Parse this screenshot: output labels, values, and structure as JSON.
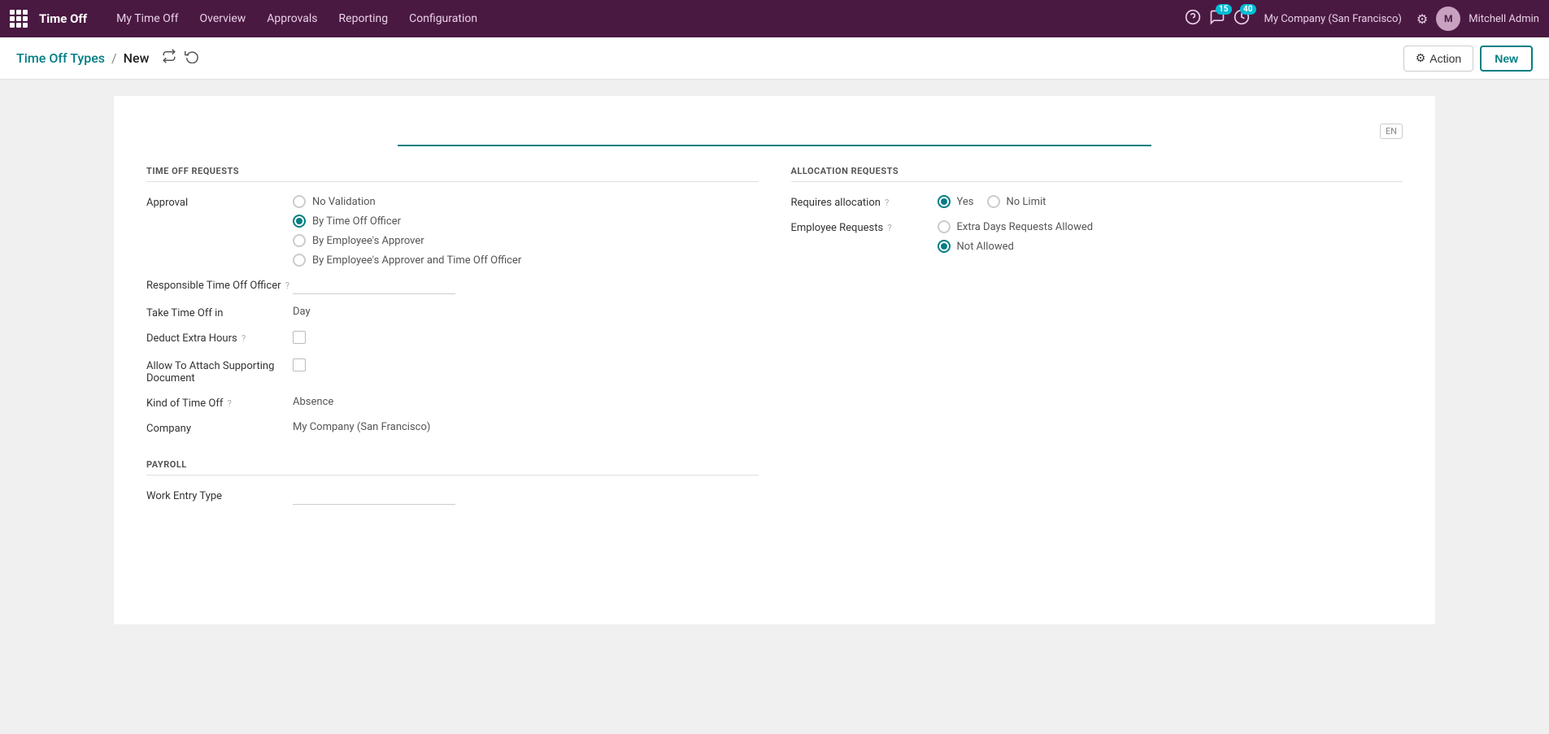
{
  "app": {
    "name": "Time Off",
    "menu": [
      "My Time Off",
      "Overview",
      "Approvals",
      "Reporting",
      "Configuration"
    ]
  },
  "topnav": {
    "badges": {
      "chat": "15",
      "clock": "40"
    },
    "company": "My Company (San Francisco)",
    "username": "Mitchell Admin"
  },
  "breadcrumb": {
    "parent": "Time Off Types",
    "current": "New",
    "action_label": "Action",
    "new_label": "New"
  },
  "form": {
    "lang": "EN",
    "title_placeholder": "",
    "time_off_requests": {
      "header": "TIME OFF REQUESTS",
      "approval_label": "Approval",
      "approval_options": [
        {
          "id": "no_validation",
          "label": "No Validation",
          "checked": false
        },
        {
          "id": "by_officer",
          "label": "By Time Off Officer",
          "checked": true
        },
        {
          "id": "by_approver",
          "label": "By Employee's Approver",
          "checked": false
        },
        {
          "id": "by_both",
          "label": "By Employee's Approver and Time Off Officer",
          "checked": false
        }
      ],
      "responsible_label": "Responsible Time Off Officer",
      "responsible_help": "?",
      "take_time_off_label": "Take Time Off in",
      "take_time_off_value": "Day",
      "deduct_hours_label": "Deduct Extra Hours",
      "deduct_hours_help": "?",
      "attach_doc_label": "Allow To Attach Supporting Document",
      "kind_label": "Kind of Time Off",
      "kind_help": "?",
      "kind_value": "Absence",
      "company_label": "Company",
      "company_value": "My Company (San Francisco)"
    },
    "allocation_requests": {
      "header": "ALLOCATION REQUESTS",
      "requires_label": "Requires allocation",
      "requires_help": "?",
      "requires_options": [
        {
          "id": "yes",
          "label": "Yes",
          "checked": true
        },
        {
          "id": "no_limit",
          "label": "No Limit",
          "checked": false
        }
      ],
      "employee_req_label": "Employee Requests",
      "employee_req_help": "?",
      "employee_req_options": [
        {
          "id": "extra_days",
          "label": "Extra Days Requests Allowed",
          "checked": false
        },
        {
          "id": "not_allowed",
          "label": "Not Allowed",
          "checked": true
        }
      ]
    },
    "payroll": {
      "header": "PAYROLL",
      "work_entry_label": "Work Entry Type"
    }
  }
}
